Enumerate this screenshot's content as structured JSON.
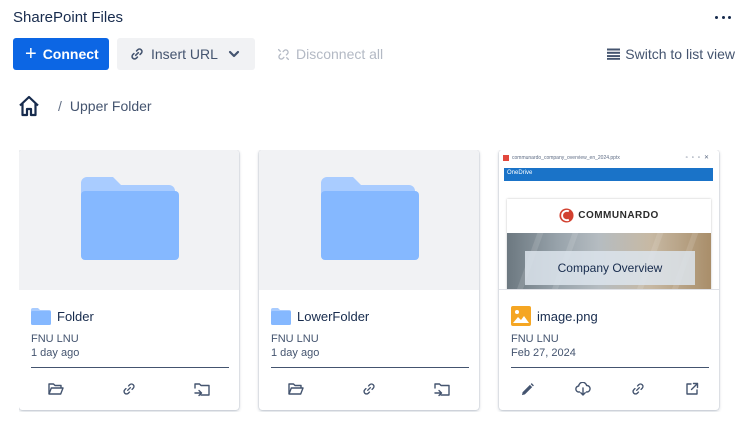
{
  "header": {
    "title": "SharePoint Files",
    "more_icon": "more-horizontal-icon"
  },
  "toolbar": {
    "connect_label": "Connect",
    "insert_url_label": "Insert URL",
    "disconnect_label": "Disconnect all",
    "list_view_label": "Switch to list view"
  },
  "breadcrumb": {
    "home_icon": "home-icon",
    "separator": "/",
    "current": "Upper Folder"
  },
  "colors": {
    "primary": "#0c66e4",
    "folder": "#85b8ff",
    "image_badge": "#f5a623"
  },
  "cards": [
    {
      "type": "folder",
      "name": "Folder",
      "owner": "FNU LNU",
      "modified": "1 day ago",
      "actions": [
        "open-folder-icon",
        "link-icon",
        "move-to-folder-icon"
      ]
    },
    {
      "type": "folder",
      "name": "LowerFolder",
      "owner": "FNU LNU",
      "modified": "1 day ago",
      "actions": [
        "open-folder-icon",
        "link-icon",
        "move-to-folder-icon"
      ]
    },
    {
      "type": "image",
      "name": "image.png",
      "owner": "FNU LNU",
      "modified": "Feb 27, 2024",
      "actions": [
        "edit-icon",
        "download-icon",
        "link-icon",
        "open-external-icon"
      ],
      "preview": {
        "filename": "communardo_company_overview_en_2024.pptx",
        "bar_text": "OneDrive",
        "logo_text": "COMMUNARDO",
        "caption": "Company Overview"
      }
    }
  ]
}
